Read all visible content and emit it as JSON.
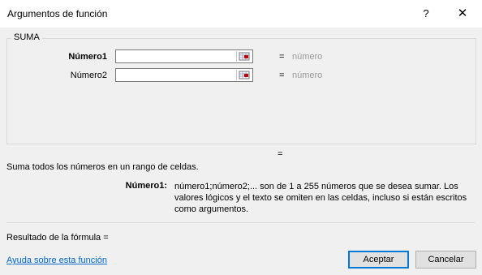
{
  "window": {
    "title": "Argumentos de función",
    "help_glyph": "?",
    "close_glyph": "✕"
  },
  "function": {
    "name": "SUMA",
    "arguments": [
      {
        "label": "Número1",
        "value": "",
        "result": "número"
      },
      {
        "label": "Número2",
        "value": "",
        "result": "número"
      }
    ],
    "eq": "=",
    "description": "Suma todos los números en un rango de celdas.",
    "arg_help_label": "Número1:",
    "arg_help_text": "número1;número2;... son de 1 a 255 números que se desea sumar. Los valores lógicos y el texto se omiten en las celdas, incluso si están escritos como argumentos."
  },
  "footer": {
    "formula_result": "Resultado de la fórmula =",
    "help_link": "Ayuda sobre esta función",
    "ok_label": "Aceptar",
    "cancel_label": "Cancelar"
  },
  "icons": {
    "ref_button": "collapse-dialog-icon"
  },
  "colors": {
    "accent": "#0078d7",
    "link": "#0066cc",
    "muted": "#9a9a9a",
    "ref_red": "#c00000"
  }
}
